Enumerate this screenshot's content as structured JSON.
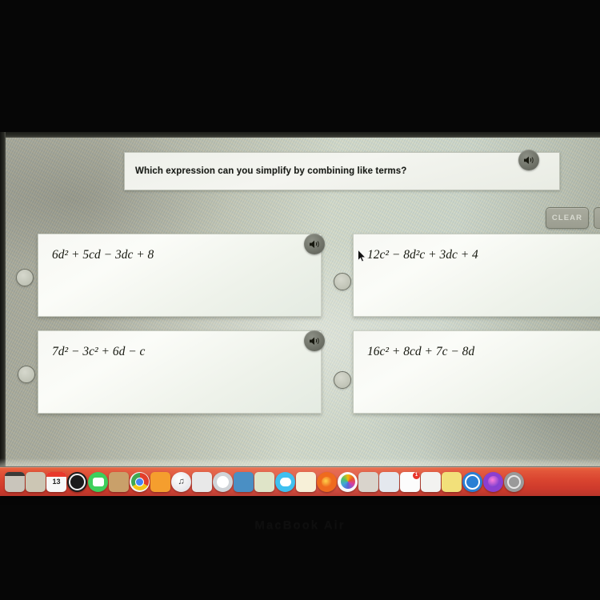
{
  "device": {
    "bezel_label": "MacBook Air"
  },
  "quiz": {
    "question": "Which expression can you simplify by combining like terms?",
    "clear_label": "CLEAR",
    "options": [
      {
        "id": "a",
        "text": "6d² + 5cd − 3dc + 8",
        "selected": false,
        "has_audio": true
      },
      {
        "id": "b",
        "text": "12c² − 8d²c + 3dc + 4",
        "selected": false,
        "has_audio": false
      },
      {
        "id": "c",
        "text": "7d² − 3c² + 6d − c",
        "selected": false,
        "has_audio": true
      },
      {
        "id": "d",
        "text": "16c² + 8cd + 7c − 8d",
        "selected": false,
        "has_audio": false
      }
    ]
  },
  "icons": {
    "question_audio": "speaker-icon",
    "option_audio": "speaker-icon",
    "cursor": "mouse-pointer-icon"
  },
  "colors": {
    "dock_background": "#d9442f",
    "screen_background": "#b9bdae",
    "card_background": "#f7f8f4",
    "clear_button": "#a9ab9e",
    "text": "#16180f"
  },
  "dock": {
    "items": [
      {
        "name": "finder",
        "label": "",
        "bg": "#c9c5bb",
        "glyph": ""
      },
      {
        "name": "file-folder",
        "label": "",
        "bg": "#ccc6b4",
        "glyph": ""
      },
      {
        "name": "calendar",
        "label": "13",
        "bg": "#f7f7f7",
        "glyph": "13"
      },
      {
        "name": "safari-compass",
        "label": "",
        "bg": "#1b1b1b",
        "glyph": ""
      },
      {
        "name": "facetime",
        "label": "",
        "bg": "#3ecf5c",
        "glyph": ""
      },
      {
        "name": "garageband",
        "label": "",
        "bg": "#c9a06a",
        "glyph": ""
      },
      {
        "name": "google-chrome",
        "label": "",
        "bg": "#f5f5f5",
        "glyph": ""
      },
      {
        "name": "ibooks",
        "label": "",
        "bg": "#f59e2e",
        "glyph": ""
      },
      {
        "name": "itunes",
        "label": "",
        "bg": "#f0f0f0",
        "glyph": "♫"
      },
      {
        "name": "photos-brush",
        "label": "",
        "bg": "#e8e8e8",
        "glyph": ""
      },
      {
        "name": "launchpad",
        "label": "",
        "bg": "#d0d4d8",
        "glyph": ""
      },
      {
        "name": "preview",
        "label": "",
        "bg": "#4a8fc4",
        "glyph": ""
      },
      {
        "name": "keynote",
        "label": "",
        "bg": "#dfe4c8",
        "glyph": ""
      },
      {
        "name": "messages",
        "label": "",
        "bg": "#3fc0f0",
        "glyph": ""
      },
      {
        "name": "notes",
        "label": "",
        "bg": "#f7f0d8",
        "glyph": ""
      },
      {
        "name": "firefox",
        "label": "",
        "bg": "#ef6a1e",
        "glyph": ""
      },
      {
        "name": "photos",
        "label": "",
        "bg": "#fafafa",
        "glyph": ""
      },
      {
        "name": "contacts",
        "label": "",
        "bg": "#d9d4cc",
        "glyph": ""
      },
      {
        "name": "news",
        "label": "",
        "bg": "#e4e8ee",
        "glyph": ""
      },
      {
        "name": "reminders",
        "label": "1",
        "bg": "#fcfcfc",
        "glyph": ""
      },
      {
        "name": "pages",
        "label": "",
        "bg": "#f2f2f0",
        "glyph": ""
      },
      {
        "name": "stickies",
        "label": "",
        "bg": "#f2e07a",
        "glyph": ""
      },
      {
        "name": "safari",
        "label": "",
        "bg": "#2a7fd4",
        "glyph": ""
      },
      {
        "name": "siri",
        "label": "",
        "bg": "#8b3fd0",
        "glyph": ""
      },
      {
        "name": "system-preferences",
        "label": "",
        "bg": "#9a9a9a",
        "glyph": ""
      }
    ]
  }
}
